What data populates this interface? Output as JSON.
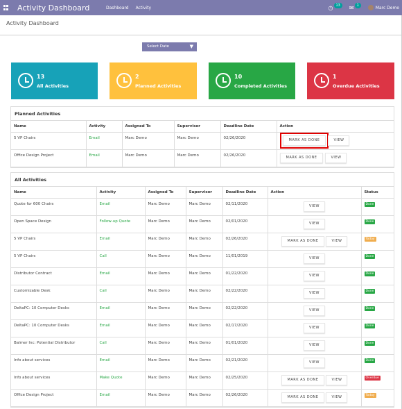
{
  "navbar": {
    "app_title": "Activity Dashboard",
    "menu": [
      "Dashboard",
      "Activity"
    ],
    "activity_badge": "13",
    "message_badge": "1",
    "user_name": "Marc Demo"
  },
  "breadcrumb": "Activity Dashboard",
  "filter": {
    "select_date_label": "Select Date"
  },
  "cards": [
    {
      "count": "13",
      "label": "All Activities",
      "color": "#17a2b8"
    },
    {
      "count": "2",
      "label": "Planned Activities",
      "color": "#ffc107"
    },
    {
      "count": "10",
      "label": "Completed Activities",
      "color": "#28a745"
    },
    {
      "count": "1",
      "label": "Overdue Activities",
      "color": "#dc3545"
    }
  ],
  "planned": {
    "title": "Planned Activities",
    "headers": [
      "Name",
      "Activity",
      "Assigned To",
      "Supervisor",
      "Deadline Date",
      "Action"
    ],
    "rows": [
      {
        "name": "5 VP Chairs",
        "activity": "Email",
        "assigned": "Marc Demo",
        "supervisor": "Marc Demo",
        "deadline": "02/26/2020"
      },
      {
        "name": "Office Design Project",
        "activity": "Email",
        "assigned": "Marc Demo",
        "supervisor": "Marc Demo",
        "deadline": "02/26/2020"
      }
    ]
  },
  "all": {
    "title": "All Activities",
    "headers": [
      "Name",
      "Activity",
      "Assigned To",
      "Supervisor",
      "Deadline Date",
      "Action",
      "Status"
    ],
    "rows": [
      {
        "name": "Quote for 600 Chairs",
        "activity": "Email",
        "assigned": "Marc Demo",
        "supervisor": "Marc Demo",
        "deadline": "02/11/2020",
        "status": "Done"
      },
      {
        "name": "Open Space Design",
        "activity": "Follow-up Quote",
        "assigned": "Marc Demo",
        "supervisor": "Marc Demo",
        "deadline": "02/01/2020",
        "status": "Done"
      },
      {
        "name": "5 VP Chairs",
        "activity": "Email",
        "assigned": "Marc Demo",
        "supervisor": "Marc Demo",
        "deadline": "02/26/2020",
        "status": "Today"
      },
      {
        "name": "5 VP Chairs",
        "activity": "Call",
        "assigned": "Marc Demo",
        "supervisor": "Marc Demo",
        "deadline": "11/01/2019",
        "status": "Done"
      },
      {
        "name": "Distributor Contract",
        "activity": "Email",
        "assigned": "Marc Demo",
        "supervisor": "Marc Demo",
        "deadline": "01/22/2020",
        "status": "Done"
      },
      {
        "name": "Customizable Desk",
        "activity": "Call",
        "assigned": "Marc Demo",
        "supervisor": "Marc Demo",
        "deadline": "02/22/2020",
        "status": "Done"
      },
      {
        "name": "DeltaPC: 10 Computer Desks",
        "activity": "Email",
        "assigned": "Marc Demo",
        "supervisor": "Marc Demo",
        "deadline": "02/22/2020",
        "status": "Done"
      },
      {
        "name": "DeltaPC: 10 Computer Desks",
        "activity": "Email",
        "assigned": "Marc Demo",
        "supervisor": "Marc Demo",
        "deadline": "02/17/2020",
        "status": "Done"
      },
      {
        "name": "Balmer Inc: Potential Distributor",
        "activity": "Call",
        "assigned": "Marc Demo",
        "supervisor": "Marc Demo",
        "deadline": "01/01/2020",
        "status": "Done"
      },
      {
        "name": "Info about services",
        "activity": "Email",
        "assigned": "Marc Demo",
        "supervisor": "Marc Demo",
        "deadline": "02/21/2020",
        "status": "Done"
      },
      {
        "name": "Info about services",
        "activity": "Make Quote",
        "assigned": "Marc Demo",
        "supervisor": "Marc Demo",
        "deadline": "02/25/2020",
        "status": "Overdue"
      },
      {
        "name": "Office Design Project",
        "activity": "Email",
        "assigned": "Marc Demo",
        "supervisor": "Marc Demo",
        "deadline": "02/26/2020",
        "status": "Today"
      }
    ]
  },
  "buttons": {
    "mark_done": "MARK AS DONE",
    "view": "VIEW"
  }
}
